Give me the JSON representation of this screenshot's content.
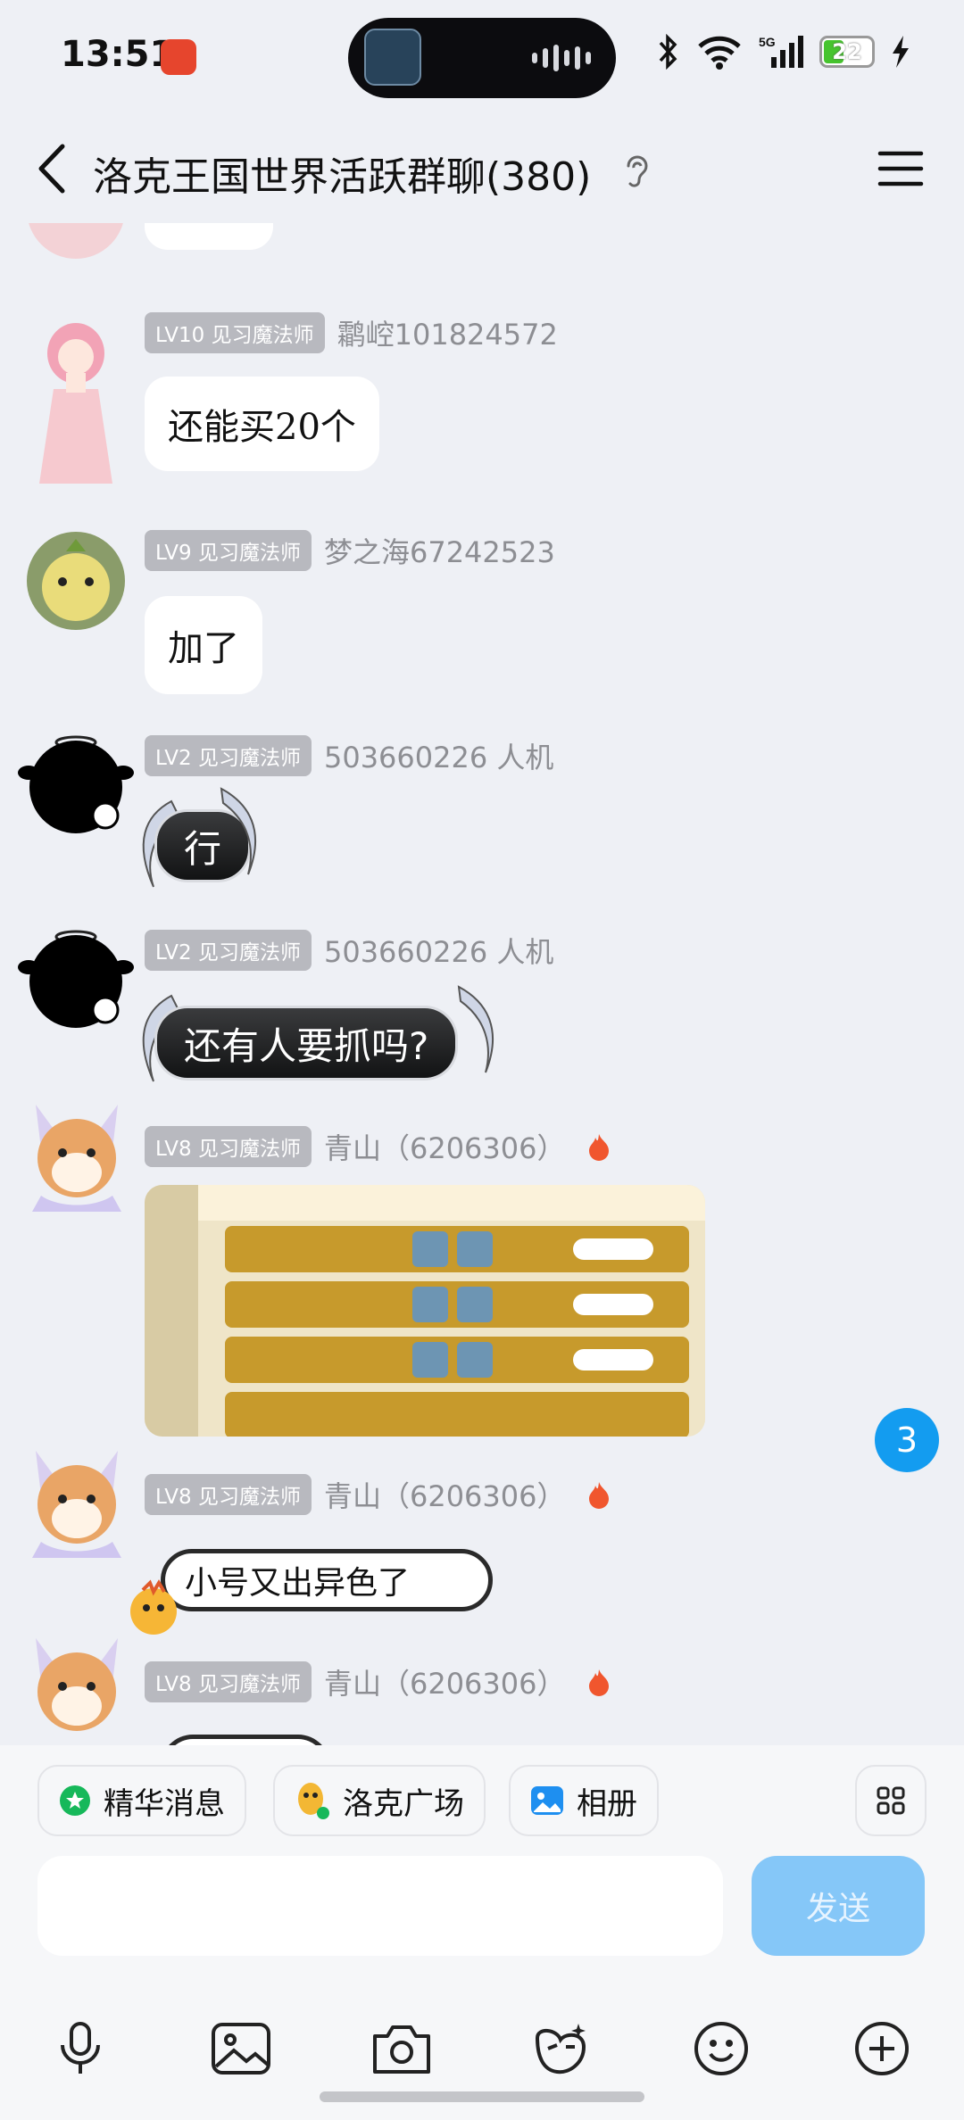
{
  "status_bar": {
    "time": "13:51",
    "battery_level": "22",
    "network": "5G"
  },
  "header": {
    "title": "洛克王国世界活跃群聊(380)"
  },
  "messages": [
    {
      "badge": "LV10 见习魔法师",
      "sender": "鹴崆101824572",
      "text": "还能买20个"
    },
    {
      "badge": "LV9 见习魔法师",
      "sender": "梦之海67242523",
      "text": "加了"
    },
    {
      "badge": "LV2 见习魔法师",
      "sender": "503660226  人机",
      "text": "行"
    },
    {
      "badge": "LV2 见习魔法师",
      "sender": "503660226  人机",
      "text": "还有人要抓吗?"
    },
    {
      "badge": "LV8 见习魔法师",
      "sender": "青山（6206306）",
      "text": ""
    },
    {
      "badge": "LV8 见习魔法师",
      "sender": "青山（6206306）",
      "text": "小号又出异色了"
    },
    {
      "badge": "LV8 见习魔法师",
      "sender": "青山（6206306）",
      "text": ""
    }
  ],
  "unread_count": "3",
  "shortcuts": [
    {
      "label": "精华消息",
      "icon": "essence-icon"
    },
    {
      "label": "洛克广场",
      "icon": "roco-plaza-icon"
    },
    {
      "label": "相册",
      "icon": "album-icon"
    }
  ],
  "composer": {
    "send_label": "发送"
  },
  "colors": {
    "accent": "#139cf0",
    "send_disabled": "#85c7f8",
    "badge": "#b8b9bf",
    "background": "#eef0f5"
  }
}
